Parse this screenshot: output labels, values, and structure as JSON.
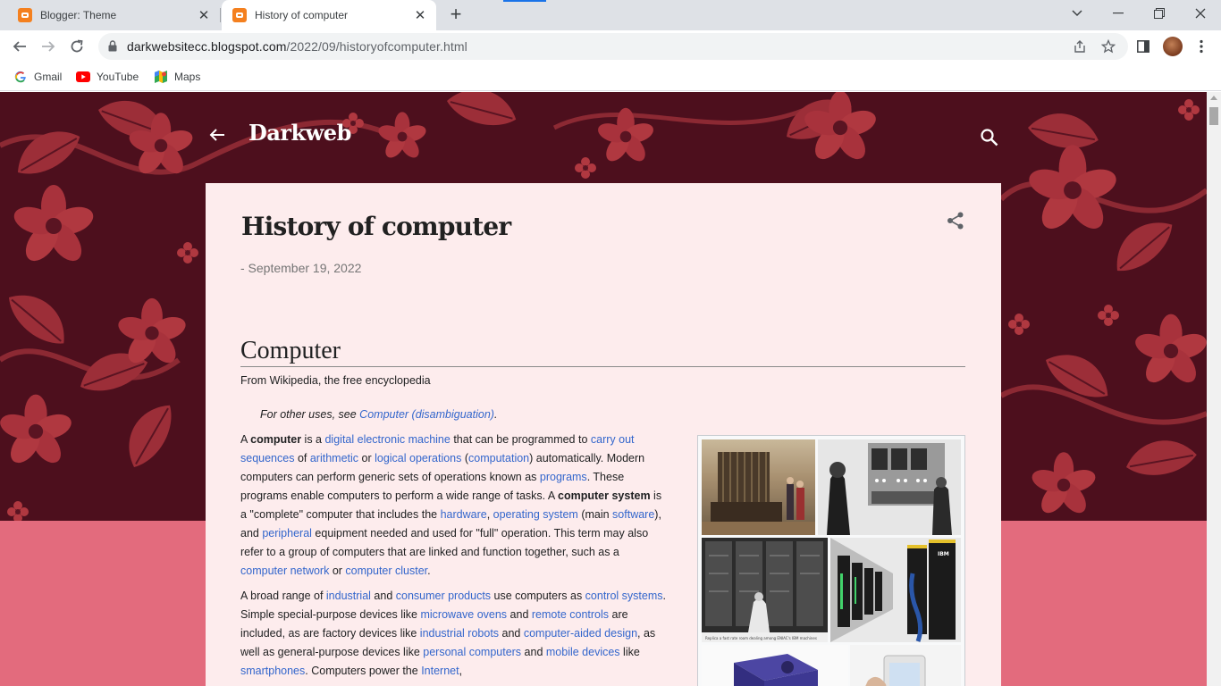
{
  "browser": {
    "tabs": [
      {
        "title": "Blogger: Theme",
        "active": false
      },
      {
        "title": "History of computer",
        "active": true
      }
    ],
    "url_host": "darkwebsitecc.blogspot.com",
    "url_path": "/2022/09/historyofcomputer.html",
    "bookmarks": [
      {
        "label": "Gmail",
        "icon": "google-icon"
      },
      {
        "label": "YouTube",
        "icon": "youtube-icon"
      },
      {
        "label": "Maps",
        "icon": "maps-icon"
      }
    ]
  },
  "blog": {
    "title": "Darkweb"
  },
  "post": {
    "title": "History of computer",
    "date": "- September 19, 2022",
    "section_heading": "Computer",
    "from_wiki": "From Wikipedia, the free encyclopedia",
    "hatnote_prefix": "For other uses, see ",
    "hatnote_link": "Computer (disambiguation)",
    "hatnote_suffix": "."
  },
  "paragraphs": [
    [
      {
        "t": "A "
      },
      {
        "t": "computer",
        "b": true
      },
      {
        "t": " is a "
      },
      {
        "t": "digital electronic machine",
        "l": true
      },
      {
        "t": " that can be programmed to "
      },
      {
        "t": "carry out sequences",
        "l": true
      },
      {
        "t": " of "
      },
      {
        "t": "arithmetic",
        "l": true
      },
      {
        "t": " or "
      },
      {
        "t": "logical operations",
        "l": true
      },
      {
        "t": " ("
      },
      {
        "t": "computation",
        "l": true
      },
      {
        "t": ") automatically. Modern computers can perform generic sets of operations known as "
      },
      {
        "t": "programs",
        "l": true
      },
      {
        "t": ". These programs enable computers to perform a wide range of tasks. A "
      },
      {
        "t": "computer system",
        "b": true
      },
      {
        "t": " is a \"complete\" computer that includes the "
      },
      {
        "t": "hardware",
        "l": true
      },
      {
        "t": ", "
      },
      {
        "t": "operating system",
        "l": true
      },
      {
        "t": " (main "
      },
      {
        "t": "software",
        "l": true
      },
      {
        "t": "), and "
      },
      {
        "t": "peripheral",
        "l": true
      },
      {
        "t": " equipment needed and used for \"full\" operation. This term may also refer to a group of computers that are linked and function together, such as a "
      },
      {
        "t": "computer network",
        "l": true
      },
      {
        "t": " or "
      },
      {
        "t": "computer cluster",
        "l": true
      },
      {
        "t": "."
      }
    ],
    [
      {
        "t": "A broad range of "
      },
      {
        "t": "industrial",
        "l": true
      },
      {
        "t": " and "
      },
      {
        "t": "consumer products",
        "l": true
      },
      {
        "t": " use computers as "
      },
      {
        "t": "control systems",
        "l": true
      },
      {
        "t": ". Simple special-purpose devices like "
      },
      {
        "t": "microwave ovens",
        "l": true
      },
      {
        "t": " and "
      },
      {
        "t": "remote controls",
        "l": true
      },
      {
        "t": " are included, as are factory devices like "
      },
      {
        "t": "industrial robots",
        "l": true
      },
      {
        "t": " and "
      },
      {
        "t": "computer-aided design",
        "l": true
      },
      {
        "t": ", as well as general-purpose devices like "
      },
      {
        "t": "personal computers",
        "l": true
      },
      {
        "t": " and "
      },
      {
        "t": "mobile devices",
        "l": true
      },
      {
        "t": " like "
      },
      {
        "t": "smartphones",
        "l": true
      },
      {
        "t": ". Computers power the "
      },
      {
        "t": "Internet",
        "l": true
      },
      {
        "t": ","
      }
    ]
  ],
  "infobox": {
    "caption_bottom_left": "Replica a fast rate room dealing among ENIAC's IBM machines"
  },
  "colors": {
    "hero_bg": "#4d0f1d",
    "floral": "#b8363f",
    "page_bg": "#e36b7d",
    "card_bg": "#fdeced",
    "link": "#3366cc",
    "tab_active_marker": "#1a73e8"
  }
}
